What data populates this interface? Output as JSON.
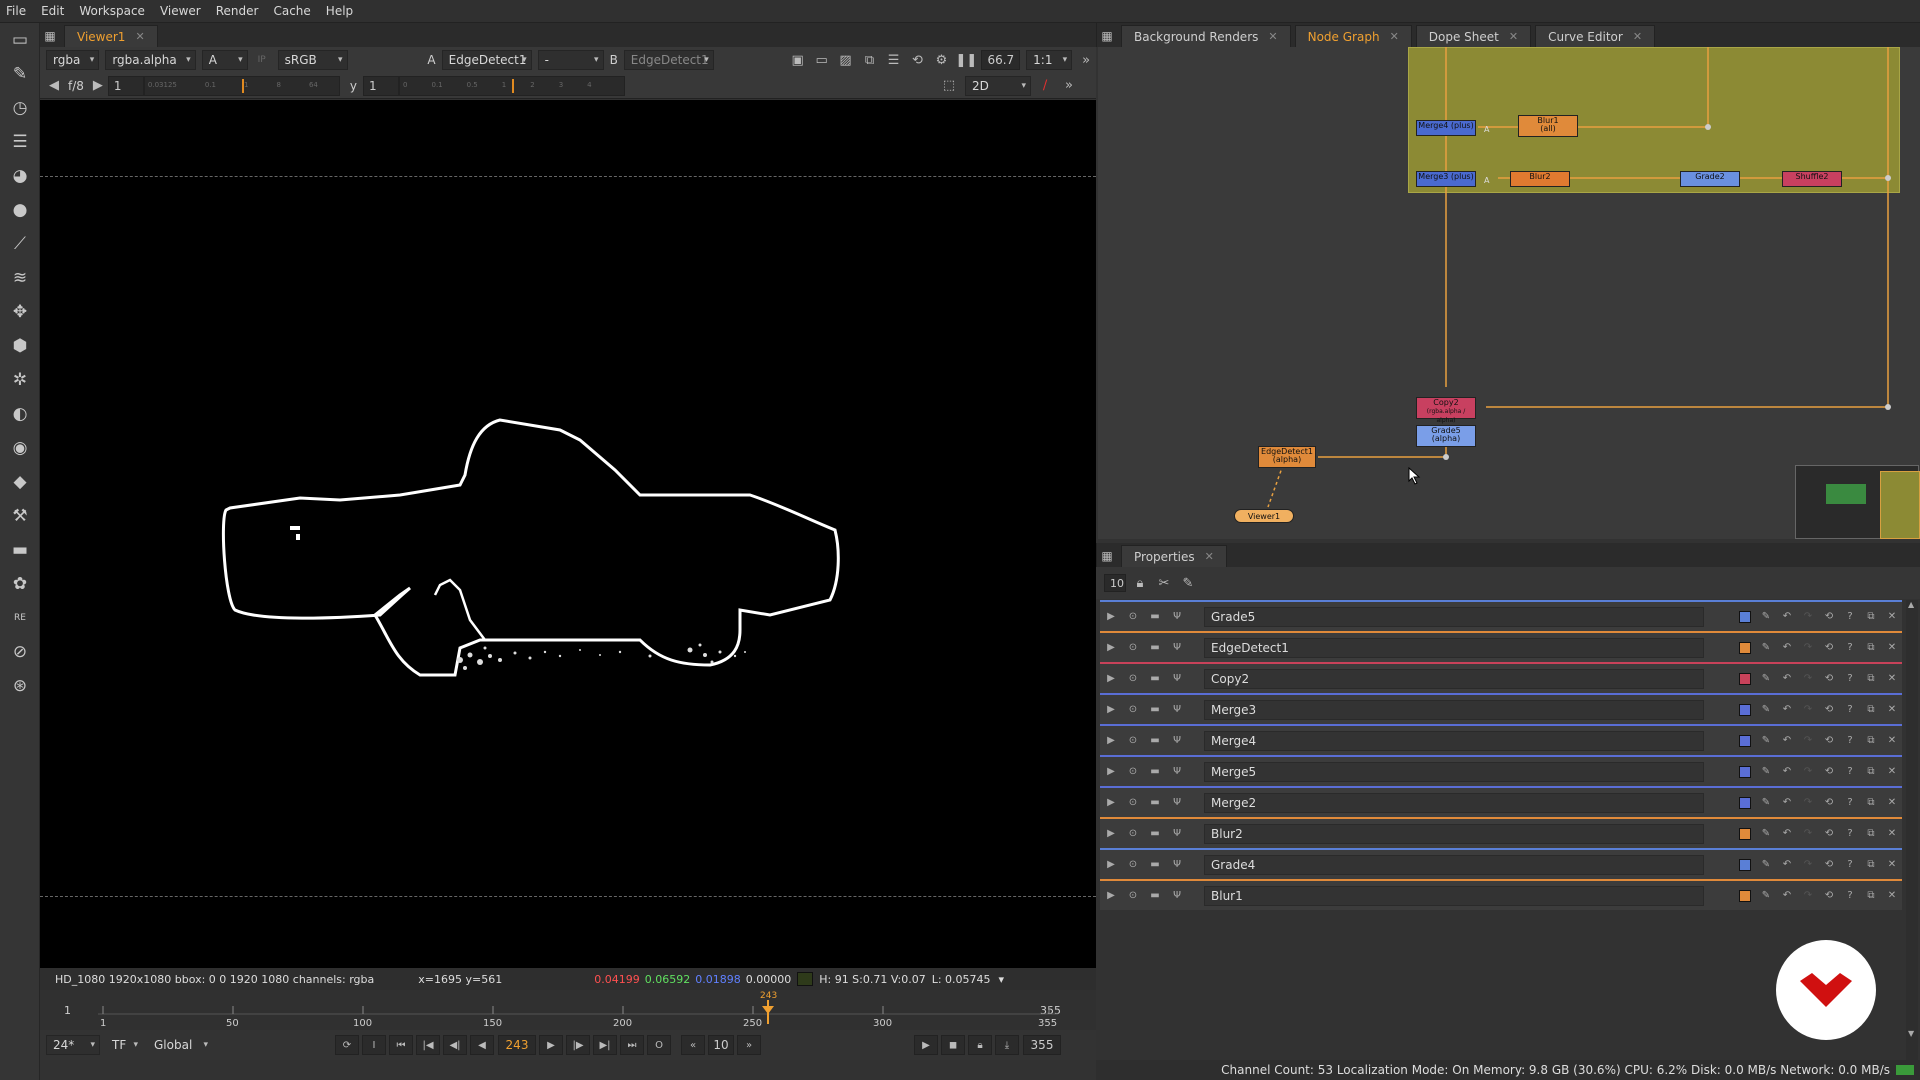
{
  "menu": [
    "File",
    "Edit",
    "Workspace",
    "Viewer",
    "Render",
    "Cache",
    "Help"
  ],
  "toolbar_icons": [
    "image-icon",
    "paint-icon",
    "time-icon",
    "channel-icon",
    "color-icon",
    "filter-icon",
    "keyer-icon",
    "merge-icon",
    "transform-icon",
    "3d-icon",
    "particles-icon",
    "deep-icon",
    "views-icon",
    "metadata-icon",
    "toolsets-icon",
    "other-icon",
    "furnace-icon",
    "re-vision-icon",
    "cara-icon",
    "ofx-icon"
  ],
  "viewer": {
    "tab": "Viewer1",
    "channels": "rgba",
    "layer": "rgba.alpha",
    "a_label": "A",
    "colorspace": "sRGB",
    "input_a_prefix": "A",
    "input_a": "EdgeDetect1",
    "op": "-",
    "input_b_prefix": "B",
    "input_b": "EdgeDetect1",
    "zoom": "66.7",
    "ratio": "1:1",
    "fstop": "f/8",
    "gain": "1",
    "y_label": "y",
    "gamma": "1",
    "view_mode": "2D",
    "gain_ticks": [
      "0.03125",
      "0.1",
      "1",
      "8",
      "64"
    ],
    "gamma_ticks": [
      "0",
      "0.1",
      "0.5",
      "1",
      "2",
      "3",
      "4"
    ]
  },
  "info": {
    "format": "HD_1080 1920x1080  bbox: 0 0 1920 1080  channels: rgba",
    "coords": "x=1695 y=561",
    "r": "0.04199",
    "g": "0.06592",
    "b": "0.01898",
    "a": "0.00000",
    "hsv": "H: 91 S:0.71 V:0.07",
    "lum": "L: 0.05745"
  },
  "timeline": {
    "start": "1",
    "end": "355",
    "current": "243",
    "ticks": [
      "1",
      "50",
      "100",
      "150",
      "200",
      "250",
      "300",
      "355"
    ],
    "fps": "24*",
    "tf": "TF",
    "range": "Global",
    "current_frame": "243",
    "step": "10",
    "end_frame": "355"
  },
  "graph": {
    "tabs": [
      "Background Renders",
      "Node Graph",
      "Dope Sheet",
      "Curve Editor"
    ],
    "active_tab": "Node Graph",
    "nodes": {
      "merge4": "Merge4 (plus)",
      "merge3": "Merge3 (plus)",
      "blur1": "Blur1",
      "blur1_sub": "(all)",
      "blur2": "Blur2",
      "grade2": "Grade2",
      "shuffle2": "Shuffle2",
      "copy2": "Copy2",
      "copy2_sub": "(rgba.alpha / alpha)",
      "grade5": "Grade5",
      "grade5_sub": "(alpha)",
      "edgedetect1": "EdgeDetect1",
      "edgedetect1_sub": "(alpha)",
      "viewer1": "Viewer1"
    },
    "input_label": "A"
  },
  "properties": {
    "tab": "Properties",
    "max_panels": "10",
    "rows": [
      {
        "name": "Grade5",
        "color": "#5a7fd6"
      },
      {
        "name": "EdgeDetect1",
        "color": "#e08a3a"
      },
      {
        "name": "Copy2",
        "color": "#c8425a"
      },
      {
        "name": "Merge3",
        "color": "#5a6ed6"
      },
      {
        "name": "Merge4",
        "color": "#5a6ed6"
      },
      {
        "name": "Merge5",
        "color": "#5a6ed6"
      },
      {
        "name": "Merge2",
        "color": "#5a6ed6"
      },
      {
        "name": "Blur2",
        "color": "#e08a3a"
      },
      {
        "name": "Grade4",
        "color": "#5a7fd6"
      },
      {
        "name": "Blur1",
        "color": "#e08a3a"
      }
    ]
  },
  "status": "Channel Count: 53  Localization Mode: On  Memory: 9.8 GB (30.6%)  CPU: 6.2%  Disk: 0.0 MB/s  Network: 0.0 MB/s",
  "colors": {
    "accent": "#f0a030",
    "backdrop": "#8c8a34"
  }
}
